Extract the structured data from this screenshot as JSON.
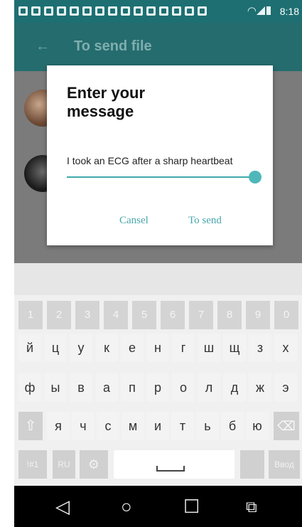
{
  "status_bar": {
    "time": "8:18",
    "wifi_icon": "wifi-icon",
    "signal_icon": "signal-icon",
    "battery_icon": "battery-icon",
    "notification_icon": "notification-icon"
  },
  "toolbar": {
    "back_icon": "arrow-left-icon",
    "title": "To send file"
  },
  "dialog": {
    "title": "Enter your message",
    "message_value": "I took an ECG after a sharp heartbeat",
    "cancel_label": "Cansel",
    "send_label": "To send"
  },
  "keyboard": {
    "numbers": [
      "1",
      "2",
      "3",
      "4",
      "5",
      "6",
      "7",
      "8",
      "9",
      "0"
    ],
    "row1": [
      "й",
      "ц",
      "у",
      "к",
      "е",
      "н",
      "г",
      "ш",
      "щ",
      "з",
      "х"
    ],
    "row2": [
      "ф",
      "ы",
      "в",
      "а",
      "п",
      "р",
      "о",
      "л",
      "д",
      "ж",
      "э"
    ],
    "row3": [
      "я",
      "ч",
      "с",
      "м",
      "и",
      "т",
      "ь",
      "б",
      "ю"
    ],
    "shift_icon": "shift-icon",
    "backspace_icon": "backspace-icon",
    "symbols_label": "!#1",
    "language_label": "RU",
    "settings_icon": "gear-icon",
    "enter_label": "Ввод"
  },
  "nav_bar": {
    "back_icon": "triangle-back-icon",
    "home_icon": "circle-home-icon",
    "recents_icon": "square-recents-icon",
    "extra_icon": "screen-switch-icon"
  },
  "colors": {
    "status_bar": "#1d6f72",
    "toolbar": "#256c6e",
    "accent": "#4aa6aa"
  }
}
